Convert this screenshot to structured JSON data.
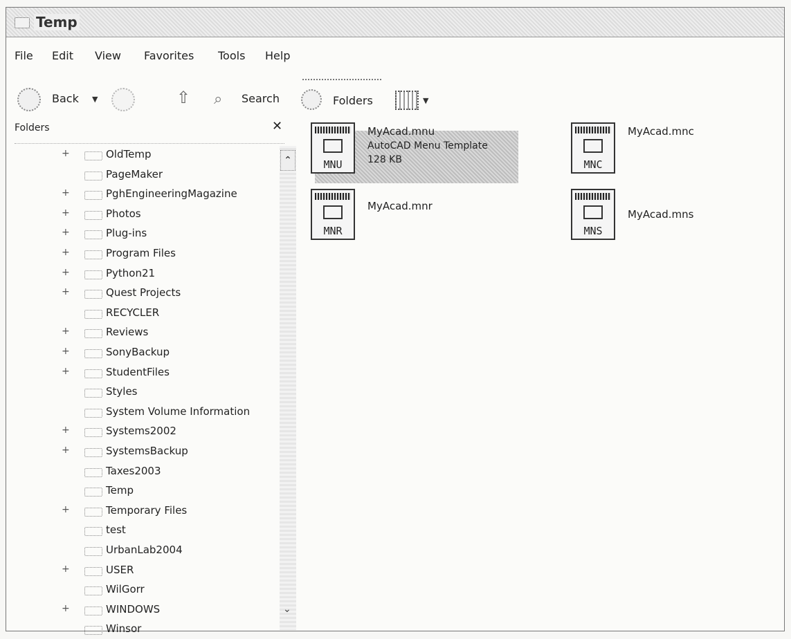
{
  "window": {
    "title": "Temp"
  },
  "menu": {
    "items": [
      "File",
      "Edit",
      "View",
      "Favorites",
      "Tools",
      "Help"
    ]
  },
  "toolbar": {
    "back_label": "Back",
    "search_label": "Search",
    "folders_label": "Folders"
  },
  "folders_pane": {
    "header": "Folders",
    "close_glyph": "✕",
    "items": [
      {
        "label": "OldTemp",
        "expandable": true
      },
      {
        "label": "PageMaker",
        "expandable": false
      },
      {
        "label": "PghEngineeringMagazine",
        "expandable": true
      },
      {
        "label": "Photos",
        "expandable": true
      },
      {
        "label": "Plug-ins",
        "expandable": true
      },
      {
        "label": "Program Files",
        "expandable": true
      },
      {
        "label": "Python21",
        "expandable": true
      },
      {
        "label": "Quest Projects",
        "expandable": true
      },
      {
        "label": "RECYCLER",
        "expandable": false
      },
      {
        "label": "Reviews",
        "expandable": true
      },
      {
        "label": "SonyBackup",
        "expandable": true
      },
      {
        "label": "StudentFiles",
        "expandable": true
      },
      {
        "label": "Styles",
        "expandable": false
      },
      {
        "label": "System Volume Information",
        "expandable": false
      },
      {
        "label": "Systems2002",
        "expandable": true
      },
      {
        "label": "SystemsBackup",
        "expandable": true
      },
      {
        "label": "Taxes2003",
        "expandable": false
      },
      {
        "label": "Temp",
        "expandable": false
      },
      {
        "label": "Temporary Files",
        "expandable": true
      },
      {
        "label": "test",
        "expandable": false
      },
      {
        "label": "UrbanLab2004",
        "expandable": false
      },
      {
        "label": "USER",
        "expandable": true
      },
      {
        "label": "WilGorr",
        "expandable": false
      },
      {
        "label": "WINDOWS",
        "expandable": true
      },
      {
        "label": "Winsor",
        "expandable": false
      }
    ]
  },
  "files": [
    {
      "name": "MyAcad.mnu",
      "ext_label": "MNU",
      "type": "AutoCAD Menu Template",
      "size": "128 KB",
      "selected": true
    },
    {
      "name": "MyAcad.mnc",
      "ext_label": "MNC",
      "type": "",
      "size": "",
      "selected": false
    },
    {
      "name": "MyAcad.mnr",
      "ext_label": "MNR",
      "type": "",
      "size": "",
      "selected": false
    },
    {
      "name": "MyAcad.mns",
      "ext_label": "MNS",
      "type": "",
      "size": "",
      "selected": false
    }
  ]
}
